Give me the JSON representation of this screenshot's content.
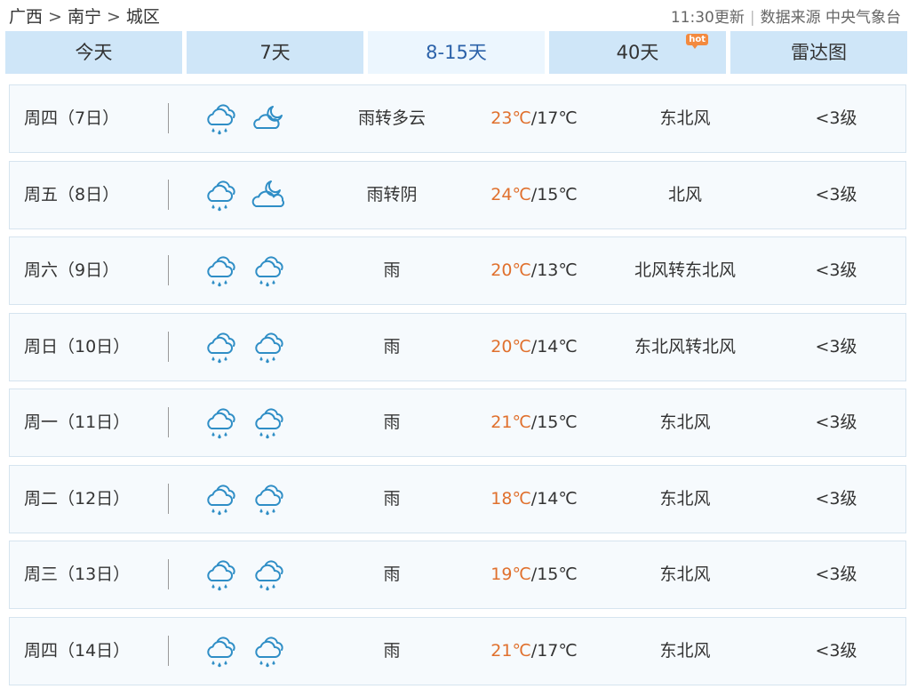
{
  "breadcrumb": [
    "广西",
    "南宁",
    "城区"
  ],
  "breadcrumb_separator": ">",
  "update_time": "11:30更新",
  "source": "数据来源 中央气象台",
  "tabs": [
    {
      "label": "今天",
      "active": false
    },
    {
      "label": "7天",
      "active": false
    },
    {
      "label": "8-15天",
      "active": true
    },
    {
      "label": "40天",
      "active": false,
      "badge": "hot"
    },
    {
      "label": "雷达图",
      "active": false
    }
  ],
  "colors": {
    "tab_bg": "#cfe6f8",
    "tab_active_bg": "#ecf6fe",
    "tab_active_text": "#2c62a9",
    "high_temp": "#e0702d",
    "icon_blue": "#2f8ec6",
    "hot_badge": "#f38a3f"
  },
  "forecast": [
    {
      "date": "周四（7日）",
      "icons": [
        "rain-cloud-icon",
        "partly-cloudy-night-icon"
      ],
      "desc": "雨转多云",
      "high": "23℃",
      "low": "/17℃",
      "wind": "东北风",
      "level": "<3级"
    },
    {
      "date": "周五（8日）",
      "icons": [
        "rain-cloud-icon",
        "overcast-night-icon"
      ],
      "desc": "雨转阴",
      "high": "24℃",
      "low": "/15℃",
      "wind": "北风",
      "level": "<3级"
    },
    {
      "date": "周六（9日）",
      "icons": [
        "rain-cloud-icon",
        "rain-cloud-icon"
      ],
      "desc": "雨",
      "high": "20℃",
      "low": "/13℃",
      "wind": "北风转东北风",
      "level": "<3级"
    },
    {
      "date": "周日（10日）",
      "icons": [
        "rain-cloud-icon",
        "rain-cloud-icon"
      ],
      "desc": "雨",
      "high": "20℃",
      "low": "/14℃",
      "wind": "东北风转北风",
      "level": "<3级"
    },
    {
      "date": "周一（11日）",
      "icons": [
        "rain-cloud-icon",
        "rain-cloud-icon"
      ],
      "desc": "雨",
      "high": "21℃",
      "low": "/15℃",
      "wind": "东北风",
      "level": "<3级"
    },
    {
      "date": "周二（12日）",
      "icons": [
        "rain-cloud-icon",
        "rain-cloud-icon"
      ],
      "desc": "雨",
      "high": "18℃",
      "low": "/14℃",
      "wind": "东北风",
      "level": "<3级"
    },
    {
      "date": "周三（13日）",
      "icons": [
        "rain-cloud-icon",
        "rain-cloud-icon"
      ],
      "desc": "雨",
      "high": "19℃",
      "low": "/15℃",
      "wind": "东北风",
      "level": "<3级"
    },
    {
      "date": "周四（14日）",
      "icons": [
        "rain-cloud-icon",
        "rain-cloud-icon"
      ],
      "desc": "雨",
      "high": "21℃",
      "low": "/17℃",
      "wind": "东北风",
      "level": "<3级"
    }
  ]
}
